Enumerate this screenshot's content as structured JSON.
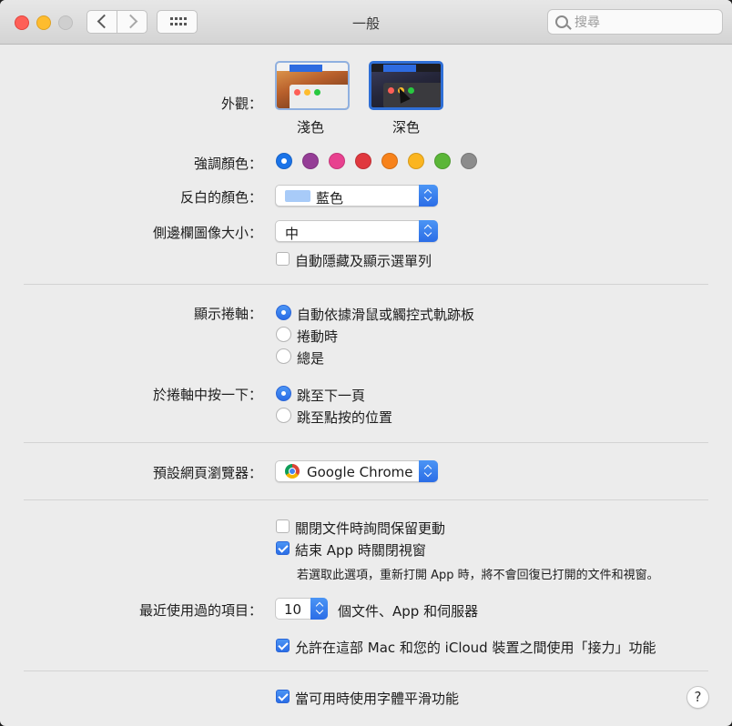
{
  "window": {
    "title": "一般"
  },
  "search": {
    "placeholder": "搜尋",
    "value": ""
  },
  "appearance": {
    "label": "外觀：",
    "options": [
      {
        "label": "淺色",
        "selected": false
      },
      {
        "label": "深色",
        "selected": true
      }
    ]
  },
  "accent": {
    "label": "強調顏色：",
    "colors": [
      "#1a73e8",
      "#953d96",
      "#e8418f",
      "#e0383e",
      "#f7821b",
      "#fbb520",
      "#5bb638",
      "#8c8c8c"
    ],
    "selected_index": 0
  },
  "highlight": {
    "label": "反白的顏色：",
    "value": "藍色",
    "swatch": "#a8cbf8"
  },
  "sidebar_icon_size": {
    "label": "側邊欄圖像大小：",
    "value": "中"
  },
  "auto_hide_menubar": {
    "label": "自動隱藏及顯示選單列",
    "checked": false
  },
  "show_scrollbars": {
    "label": "顯示捲軸：",
    "options": [
      "自動依據滑鼠或觸控式軌跡板",
      "捲動時",
      "總是"
    ],
    "selected_index": 0
  },
  "click_scrollbar": {
    "label": "於捲軸中按一下：",
    "options": [
      "跳至下一頁",
      "跳至點按的位置"
    ],
    "selected_index": 0
  },
  "default_browser": {
    "label": "預設網頁瀏覽器：",
    "value": "Google Chrome"
  },
  "ask_keep_changes": {
    "label": "關閉文件時詢問保留更動",
    "checked": false
  },
  "close_windows": {
    "label": "結束 App 時關閉視窗",
    "checked": true,
    "note": "若選取此選項，重新打開 App 時，將不會回復已打開的文件和視窗。"
  },
  "recent_items": {
    "label": "最近使用過的項目：",
    "value": "10",
    "suffix": "個文件、App 和伺服器"
  },
  "handoff": {
    "label": "允許在這部 Mac 和您的 iCloud 裝置之間使用「接力」功能",
    "checked": true
  },
  "font_smoothing": {
    "label": "當可用時使用字體平滑功能",
    "checked": true
  },
  "help": {
    "label": "?"
  }
}
